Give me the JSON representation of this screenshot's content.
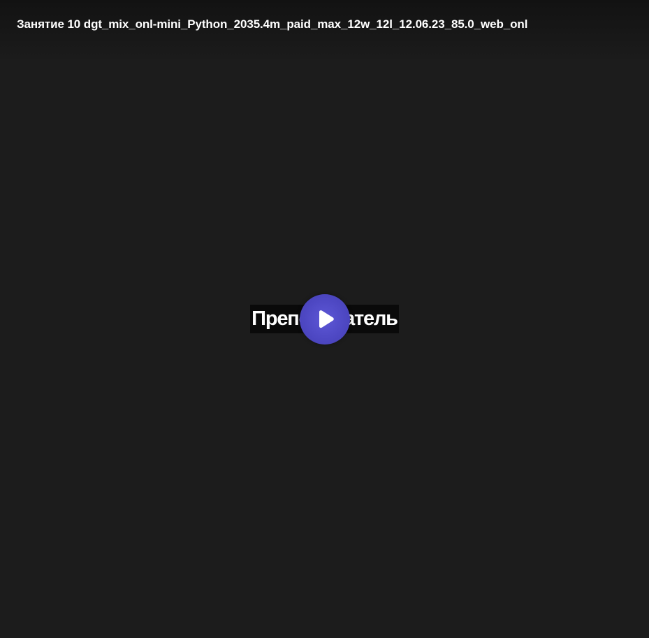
{
  "player": {
    "title": "Занятие 10 dgt_mix_onl-mini_Python_2035.4m_paid_max_12w_12l_12.06.23_85.0_web_onl",
    "frame_caption": "Преподаватель",
    "play_icon": "play-icon",
    "colors": {
      "background": "#1c1c1c",
      "play_button": "#4d47c2",
      "caption_bg": "#0a0a0a",
      "text": "#ffffff"
    }
  }
}
